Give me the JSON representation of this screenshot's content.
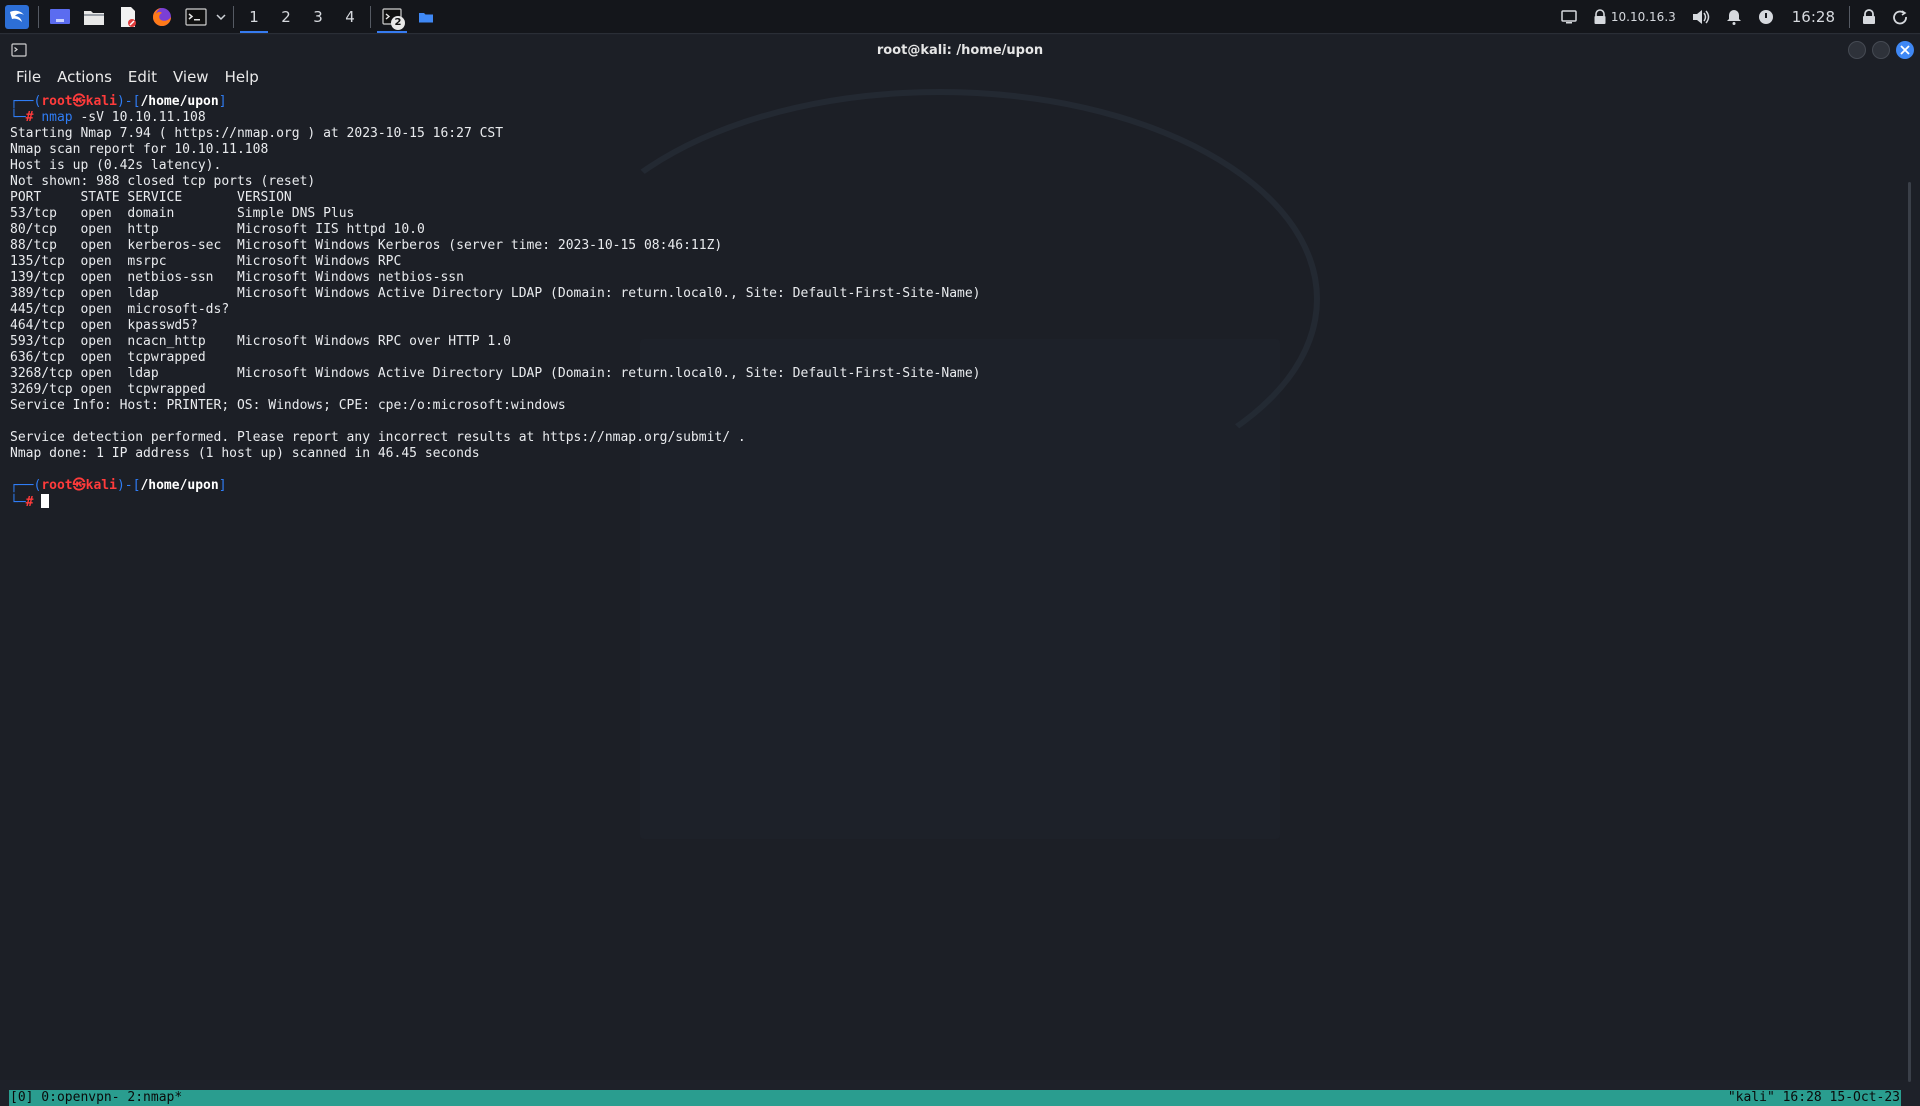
{
  "taskbar": {
    "workspaces": [
      "1",
      "2",
      "3",
      "4"
    ],
    "active_workspace": "1",
    "terminal_task_badge": "2",
    "tray": {
      "vpn_ip": "10.10.16.3",
      "clock": "16:28"
    }
  },
  "window": {
    "title": "root@kali: /home/upon",
    "menu": [
      "File",
      "Actions",
      "Edit",
      "View",
      "Help"
    ]
  },
  "prompt": {
    "user": "root",
    "host": "kali",
    "path": "/home/upon",
    "symbol": "#"
  },
  "command": "nmap -sV 10.10.11.108",
  "command_name": "nmap",
  "command_args": " -sV 10.10.11.108",
  "output": [
    "Starting Nmap 7.94 ( https://nmap.org ) at 2023-10-15 16:27 CST",
    "Nmap scan report for 10.10.11.108",
    "Host is up (0.42s latency).",
    "Not shown: 988 closed tcp ports (reset)",
    "PORT     STATE SERVICE       VERSION",
    "53/tcp   open  domain        Simple DNS Plus",
    "80/tcp   open  http          Microsoft IIS httpd 10.0",
    "88/tcp   open  kerberos-sec  Microsoft Windows Kerberos (server time: 2023-10-15 08:46:11Z)",
    "135/tcp  open  msrpc         Microsoft Windows RPC",
    "139/tcp  open  netbios-ssn   Microsoft Windows netbios-ssn",
    "389/tcp  open  ldap          Microsoft Windows Active Directory LDAP (Domain: return.local0., Site: Default-First-Site-Name)",
    "445/tcp  open  microsoft-ds?",
    "464/tcp  open  kpasswd5?",
    "593/tcp  open  ncacn_http    Microsoft Windows RPC over HTTP 1.0",
    "636/tcp  open  tcpwrapped",
    "3268/tcp open  ldap          Microsoft Windows Active Directory LDAP (Domain: return.local0., Site: Default-First-Site-Name)",
    "3269/tcp open  tcpwrapped",
    "Service Info: Host: PRINTER; OS: Windows; CPE: cpe:/o:microsoft:windows",
    "",
    "Service detection performed. Please report any incorrect results at https://nmap.org/submit/ .",
    "Nmap done: 1 IP address (1 host up) scanned in 46.45 seconds",
    ""
  ],
  "tmux": {
    "left": "[0] 0:openvpn- 2:nmap*",
    "right": "\"kali\" 16:28 15-Oct-23"
  },
  "colors": {
    "prompt_frame": "#2f7df6",
    "prompt_user": "#ff3b3b",
    "tmux_bar": "#2a9d8f",
    "accent": "#367bf0"
  }
}
